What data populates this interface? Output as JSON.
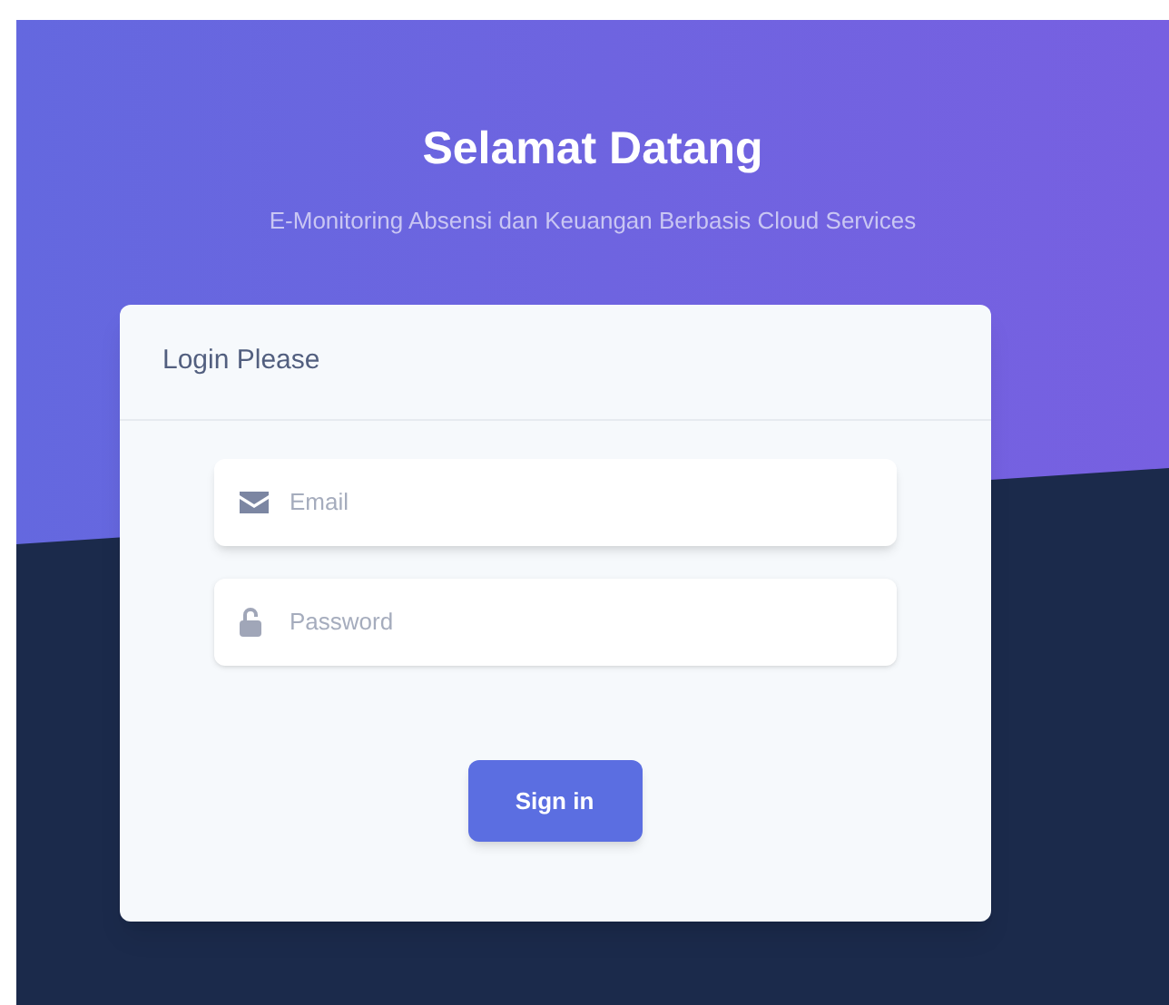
{
  "header": {
    "title": "Selamat Datang",
    "subtitle": "E-Monitoring Absensi dan Keuangan Berbasis Cloud Services"
  },
  "card": {
    "title": "Login Please",
    "fields": [
      {
        "kind": "email",
        "placeholder": "Email"
      },
      {
        "kind": "password",
        "placeholder": "Password"
      }
    ],
    "button": "Sign in"
  }
}
